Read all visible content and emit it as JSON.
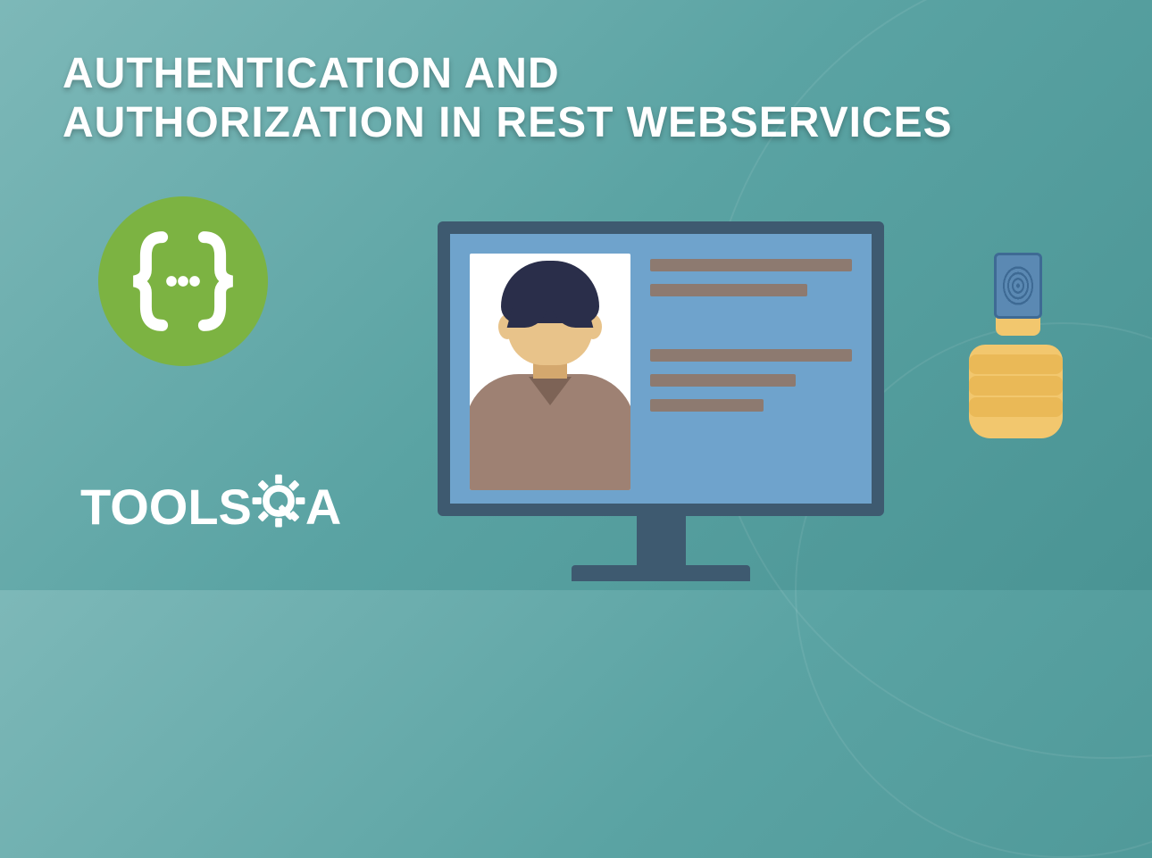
{
  "title_line1": "AUTHENTICATION AND",
  "title_line2": "AUTHORIZATION IN REST WEBSERVICES",
  "logo": {
    "text_before": "TOOLS",
    "text_after": "A"
  },
  "colors": {
    "badge": "#7cb342",
    "monitor_frame": "#3e5a70",
    "screen": "#6fa3cc",
    "skin": "#e8c38a",
    "hair": "#2a2e4a",
    "shirt": "#9e8173",
    "hand": "#f2c76e",
    "chip": "#5b89b3"
  }
}
